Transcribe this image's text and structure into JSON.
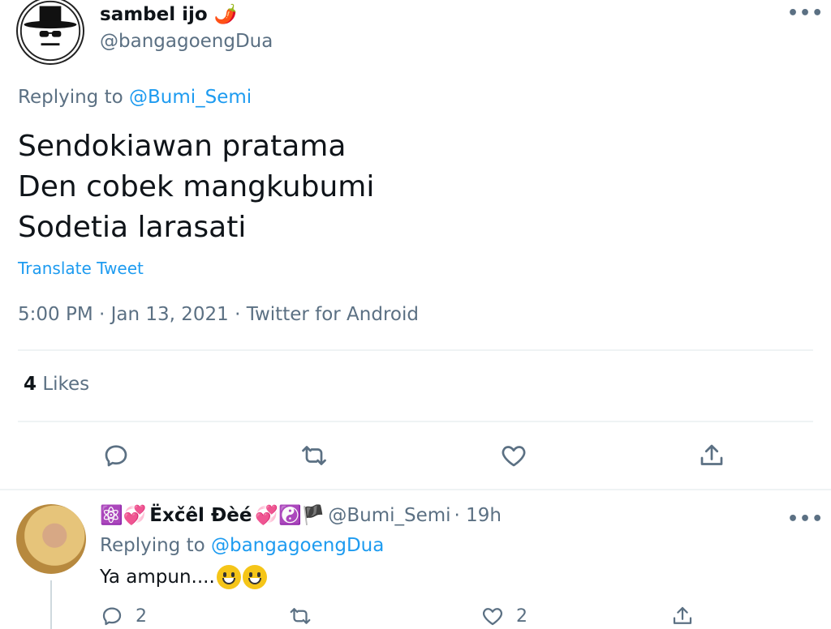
{
  "main_tweet": {
    "name": "sambel ijo",
    "name_emoji": "🌶️",
    "handle": "@bangagoengDua",
    "more_icon": "more-dots-icon",
    "replying_label": "Replying to",
    "replying_handle": "@Bumi_Semi",
    "text_lines": [
      "Sendokiawan pratama",
      "Den cobek mangkubumi",
      "Sodetia larasati"
    ],
    "translate": "Translate Tweet",
    "timestamp": "5:00 PM · Jan 13, 2021 · Twitter for Android",
    "likes_count": "4",
    "likes_label": "Likes",
    "actions": [
      "reply-icon",
      "retweet-icon",
      "like-icon",
      "share-icon"
    ]
  },
  "reply_tweet": {
    "name_prefix_emoji": "⚛️💞",
    "name": "Ëxčêl Đèé",
    "name_suffix_emoji": "💞☯️🏴",
    "handle": "@Bumi_Semi",
    "time": "· 19h",
    "replying_label": "Replying to",
    "replying_handle": "@bangagoengDua",
    "text": "Ya ampun....",
    "reply_count": "2",
    "like_count": "2"
  },
  "colors": {
    "link": "#1d9bf0",
    "muted": "#5b7083",
    "divider": "#eff3f4",
    "text": "#0f1419"
  }
}
